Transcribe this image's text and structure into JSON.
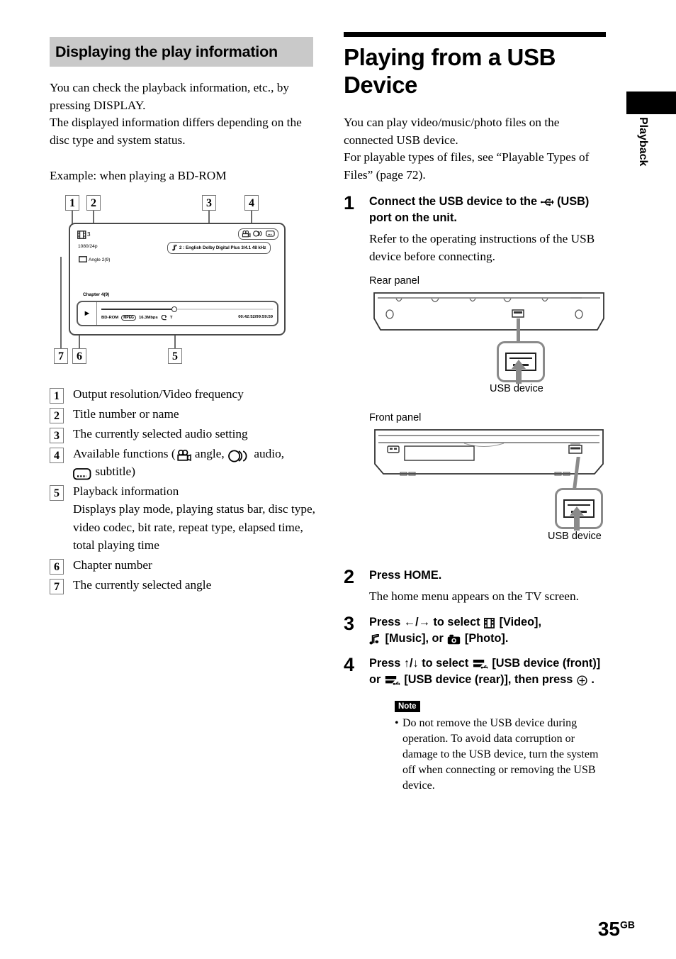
{
  "left": {
    "section_heading": "Displaying the play information",
    "paragraph_1": "You can check the playback information, etc., by pressing DISPLAY.",
    "paragraph_2": "The displayed information differs depending on the disc type and system status.",
    "example_caption": "Example: when playing a BD-ROM",
    "osd": {
      "callouts": [
        "1",
        "2",
        "3",
        "4",
        "5",
        "6",
        "7"
      ],
      "title_number": "3",
      "output_resolution": "1080/24p",
      "angle": "Angle  2(9)",
      "audio_setting": "2 : English  Dolby Digital Plus  3/4.1 48 kHz",
      "chapter": "Chapter 4(9)",
      "disc_type": "BD-ROM",
      "video_codec": "MPEG",
      "bit_rate": "16.3Mbps",
      "repeat_type": "T",
      "time": "00:42:52/99:59:59",
      "function_icons": [
        "angle-icon",
        "audio-icon",
        "subtitle-icon"
      ],
      "play_icon": "play-icon",
      "note_icon": "music-note-icon"
    },
    "items": [
      {
        "num": "1",
        "text": "Output resolution/Video frequency"
      },
      {
        "num": "2",
        "text": "Title number or name"
      },
      {
        "num": "3",
        "text": "The currently selected audio setting"
      },
      {
        "num": "4",
        "text_part_1": "Available functions (",
        "text_part_2": " angle, ",
        "text_part_3": " audio, ",
        "text_part_4": " subtitle)"
      },
      {
        "num": "5",
        "text": "Playback information",
        "sub": "Displays play mode, playing status bar, disc type, video codec, bit rate, repeat type, elapsed time, total playing time"
      },
      {
        "num": "6",
        "text": "Chapter number"
      },
      {
        "num": "7",
        "text": "The currently selected angle"
      }
    ]
  },
  "right": {
    "title": "Playing from a USB Device",
    "intro_1": "You can play video/music/photo files on the connected USB device.",
    "intro_2": "For playable types of files, see “Playable Types of Files” (page 72).",
    "steps": [
      {
        "num": "1",
        "bold_part_1": "Connect the USB device to the ",
        "bold_part_2": " (USB) port on the unit.",
        "sub": "Refer to the operating instructions of the USB device before connecting."
      },
      {
        "num": "2",
        "bold": "Press HOME.",
        "sub": "The home menu appears on the TV screen."
      },
      {
        "num": "3",
        "bold_part_1": "Press ←/→ to select ",
        "bold_part_2": " [Video], ",
        "bold_part_3": " [Music], or ",
        "bold_part_4": " [Photo]."
      },
      {
        "num": "4",
        "bold_part_1": "Press ↑/↓ to select ",
        "bold_part_2": " [USB device (front)] or ",
        "bold_part_3": " [USB device (rear)], then press ",
        "bold_part_4": " ."
      }
    ],
    "rear_panel_label": "Rear panel",
    "front_panel_label": "Front panel",
    "usb_device_label_rear": "USB device",
    "usb_device_label_front": "USB device",
    "note": {
      "badge": "Note",
      "bullet": "•",
      "text": "Do not remove the USB device during operation. To avoid data corruption or damage to the USB device, turn the system off when connecting or removing the USB device."
    }
  },
  "side_tab": {
    "label": "Playback"
  },
  "footer": {
    "page_number": "35",
    "page_suffix": "GB"
  },
  "colors": {
    "heading_bg": "#c9c9c9",
    "rule": "#000000",
    "diagram_stroke": "#4a4a4a",
    "arrow": "#8a8a8a"
  }
}
